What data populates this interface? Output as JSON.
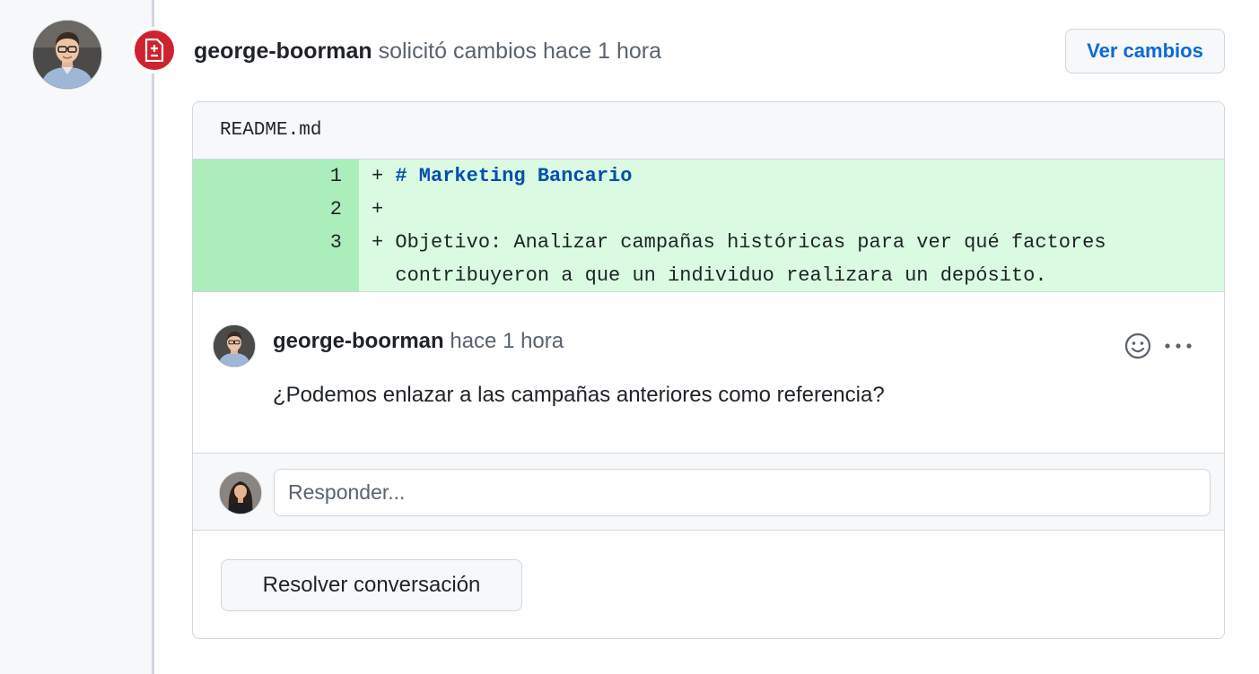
{
  "timeline": {
    "reviewer": "george-boorman",
    "action_text": "solicitó cambios hace 1 hora",
    "view_changes_label": "Ver cambios",
    "badge_icon": "file-diff-icon",
    "badge_color": "#cf222e"
  },
  "file": {
    "name": "README.md",
    "lines": [
      {
        "num": "1",
        "marker": "+",
        "text": "# Marketing Bancario",
        "heading": true
      },
      {
        "num": "2",
        "marker": "+",
        "text": "",
        "heading": false
      },
      {
        "num": "3",
        "marker": "+",
        "text": "Objetivo: Analizar campañas históricas para ver qué factores",
        "heading": false
      },
      {
        "num": "",
        "marker": "",
        "text": "contribuyeron a que un individuo realizara un depósito.",
        "heading": false
      }
    ]
  },
  "comment": {
    "author": "george-boorman",
    "time": "hace 1 hora",
    "body": "¿Podemos enlazar a las campañas anteriores como referencia?",
    "emoji_icon": "smiley-icon",
    "more_icon": "kebab-horizontal-icon"
  },
  "reply": {
    "placeholder": "Responder..."
  },
  "resolve_label": "Resolver conversación",
  "colors": {
    "added_line_bg": "#dafbe1",
    "added_num_bg": "#aceebb",
    "link_blue": "#0969da",
    "heading_blue": "#0550ae"
  }
}
